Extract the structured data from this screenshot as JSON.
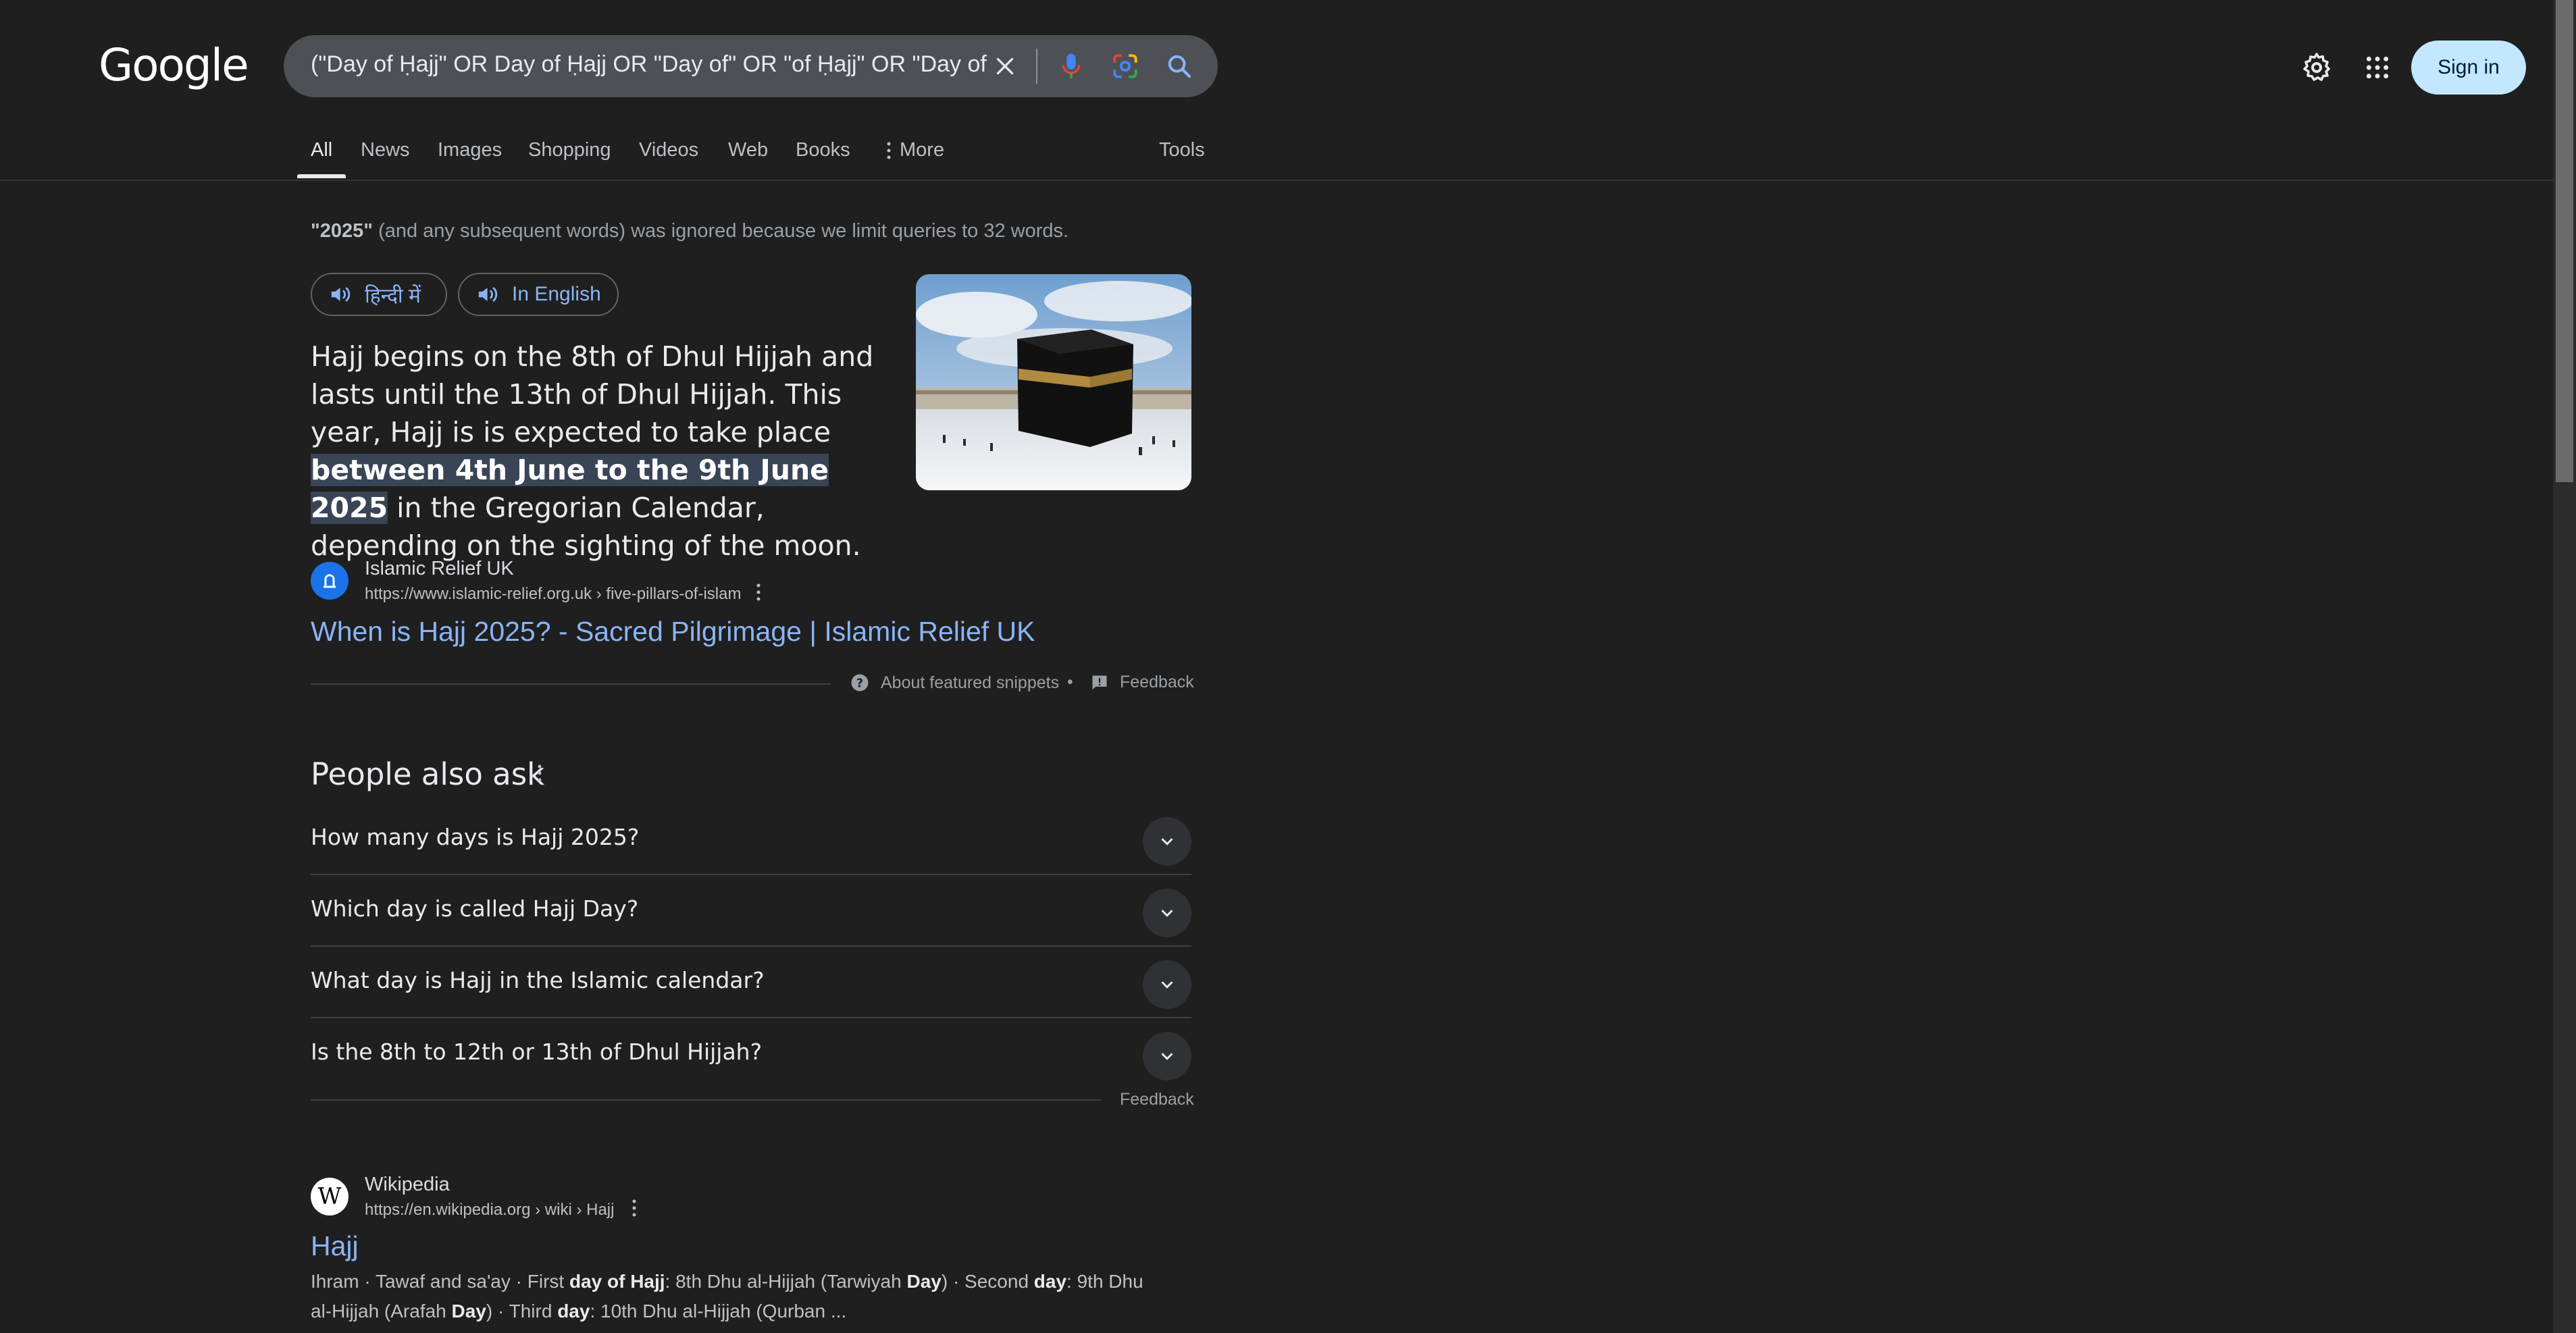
{
  "header": {
    "logo": "Google",
    "search_query": "(\"Day of Ḥajj\" OR Day of Ḥajj OR \"Day of\" OR \"of Ḥajj\" OR \"Day of Hajj",
    "sign_in": "Sign in"
  },
  "tabs": [
    "All",
    "News",
    "Images",
    "Shopping",
    "Videos",
    "Web",
    "Books",
    "More"
  ],
  "tools": "Tools",
  "notice": {
    "word": "\"2025\"",
    "rest": " (and any subsequent words) was ignored because we limit queries to 32 words."
  },
  "featured": {
    "lang_hindi": "हिन्दी में",
    "lang_english": "In English",
    "text_before": "Hajj begins on the 8th of Dhul Hijjah and lasts until the 13th of Dhul Hijjah. This year, Hajj is is expected to take place ",
    "text_highlight": "between 4th June to the 9th June 2025",
    "text_after": " in the Gregorian Calendar, depending on the sighting of the moon.",
    "source_name": "Islamic Relief UK",
    "source_url": "https://www.islamic-relief.org.uk › five-pillars-of-islam",
    "title": "When is Hajj 2025? - Sacred Pilgrimage | Islamic Relief UK",
    "about": "About featured snippets",
    "separator": "•",
    "feedback": "Feedback"
  },
  "paa": {
    "title": "People also ask",
    "questions": [
      "How many days is Hajj 2025?",
      "Which day is called Hajj Day?",
      "What day is Hajj in the Islamic calendar?",
      "Is the 8th to 12th or 13th of Dhul Hijjah?"
    ],
    "feedback": "Feedback"
  },
  "wiki": {
    "favicon_letter": "W",
    "name": "Wikipedia",
    "url": "https://en.wikipedia.org › wiki › Hajj",
    "title": "Hajj",
    "desc_parts": [
      {
        "t": "Ihram · Tawaf and sa'ay · First ",
        "b": false
      },
      {
        "t": "day of Hajj",
        "b": true
      },
      {
        "t": ": 8th Dhu al-Hijjah (Tarwiyah ",
        "b": false
      },
      {
        "t": "Day",
        "b": true
      },
      {
        "t": ") · Second ",
        "b": false
      },
      {
        "t": "day",
        "b": true
      },
      {
        "t": ": 9th Dhu al-Hijjah (Arafah ",
        "b": false
      },
      {
        "t": "Day",
        "b": true
      },
      {
        "t": ") · Third ",
        "b": false
      },
      {
        "t": "day",
        "b": true
      },
      {
        "t": ": 10th Dhu al-Hijjah (Qurban ...",
        "b": false
      }
    ]
  },
  "colors": {
    "background": "#1f1f1f",
    "link": "#8ab4f8",
    "highlight": "#394457",
    "signin_bg": "#c2e7ff"
  }
}
